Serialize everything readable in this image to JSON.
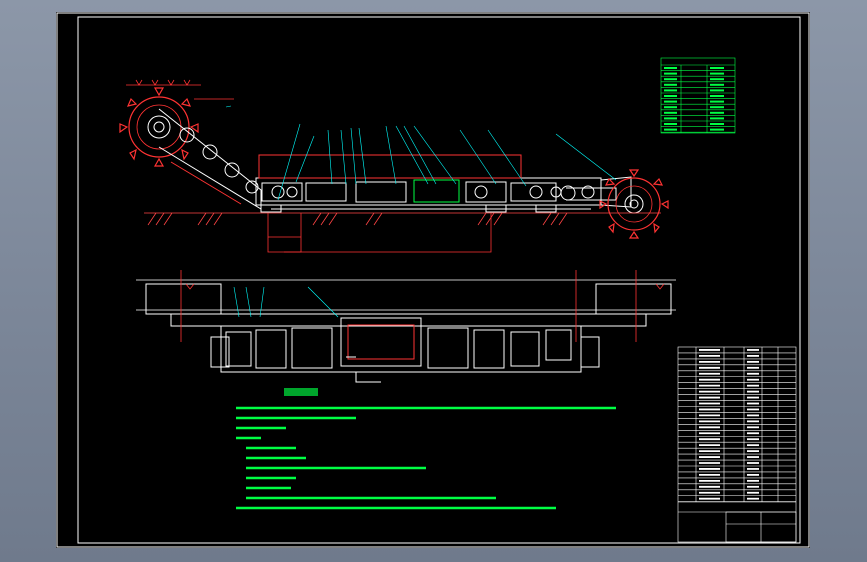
{
  "drawing": {
    "type": "CAD assembly drawing",
    "colors": {
      "background": "#000000",
      "frame": "#ffffff",
      "machine_body": "#ffffff",
      "cutter_drum": "#ff3333",
      "leader_lines": "#00ffff",
      "notes_text": "#00ff44",
      "ground_hatch": "#ff4444",
      "table_text": "#ffffff"
    }
  }
}
